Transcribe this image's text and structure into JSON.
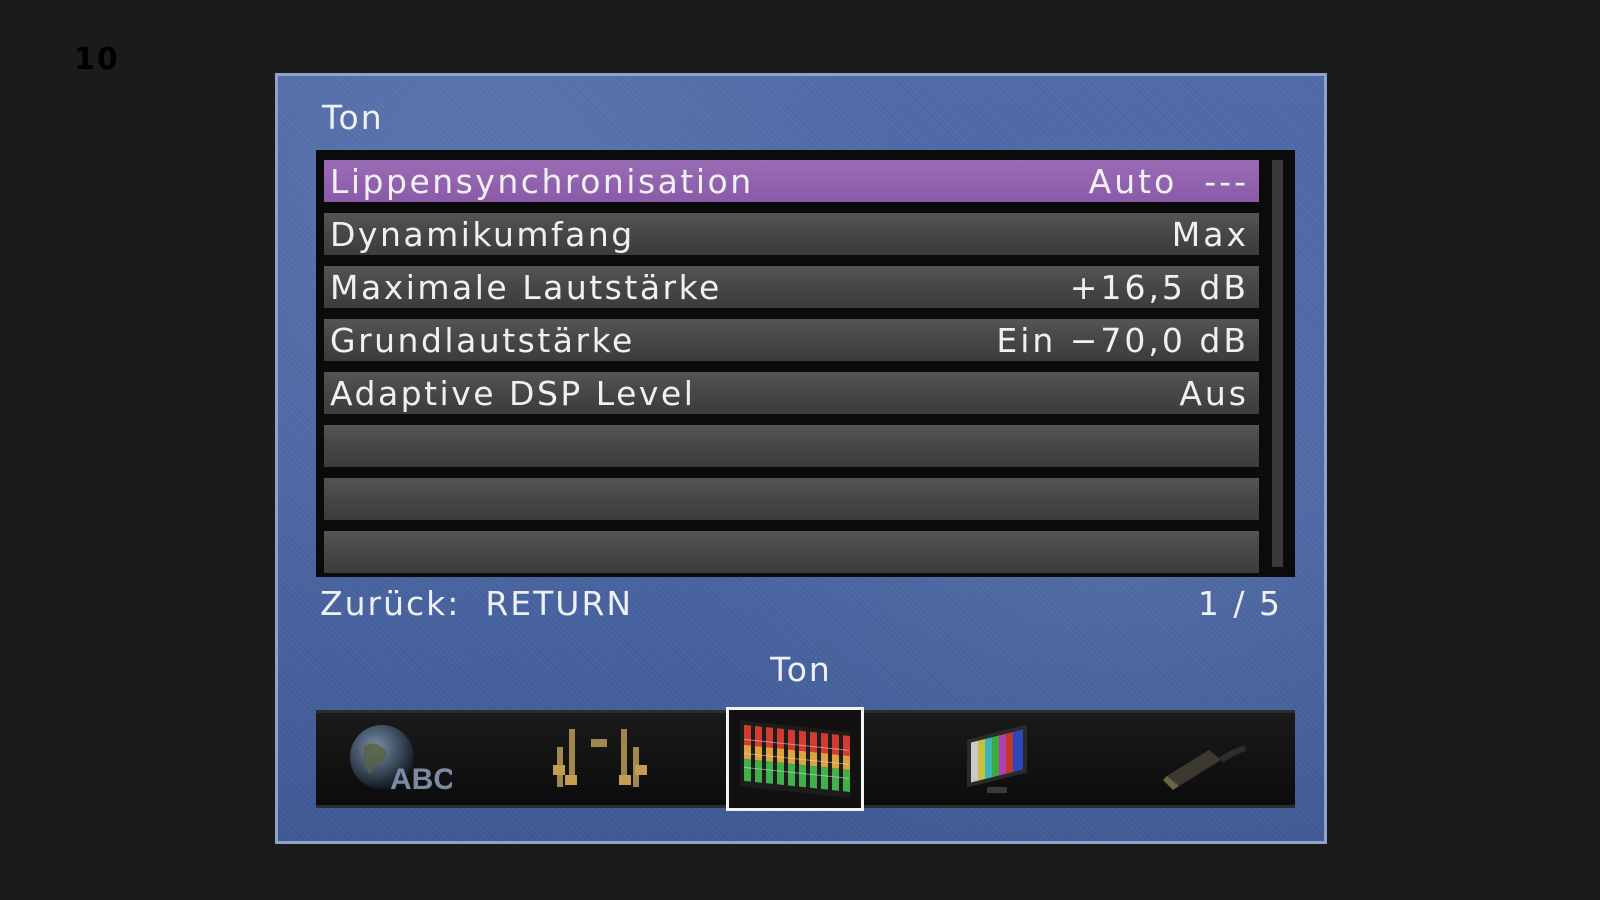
{
  "channel_number": "10",
  "menu": {
    "title": "Ton",
    "items": [
      {
        "label": "Lippensynchronisation",
        "value": "Auto  ---"
      },
      {
        "label": "Dynamikumfang",
        "value": "Max"
      },
      {
        "label": "Maximale Lautstärke",
        "value": "+16,5 dB"
      },
      {
        "label": "Grundlautstärke",
        "value": "Ein −70,0 dB"
      },
      {
        "label": "Adaptive DSP Level",
        "value": "Aus"
      }
    ],
    "selected_index": 0
  },
  "footer": {
    "back_hint": "Zurück:  RETURN",
    "page_indicator": "1 / 5"
  },
  "category_bar": {
    "current_label": "Ton",
    "icons": [
      {
        "name": "language-globe-icon",
        "text": "ABC"
      },
      {
        "name": "speaker-setup-icon"
      },
      {
        "name": "sound-equalizer-icon"
      },
      {
        "name": "display-color-bars-icon"
      },
      {
        "name": "hdmi-cable-icon"
      }
    ],
    "active_index": 2
  },
  "colors": {
    "panel_blue": "#4b66a4",
    "highlight_purple": "#8f60ad",
    "row_gray": "#4a4a4a"
  }
}
